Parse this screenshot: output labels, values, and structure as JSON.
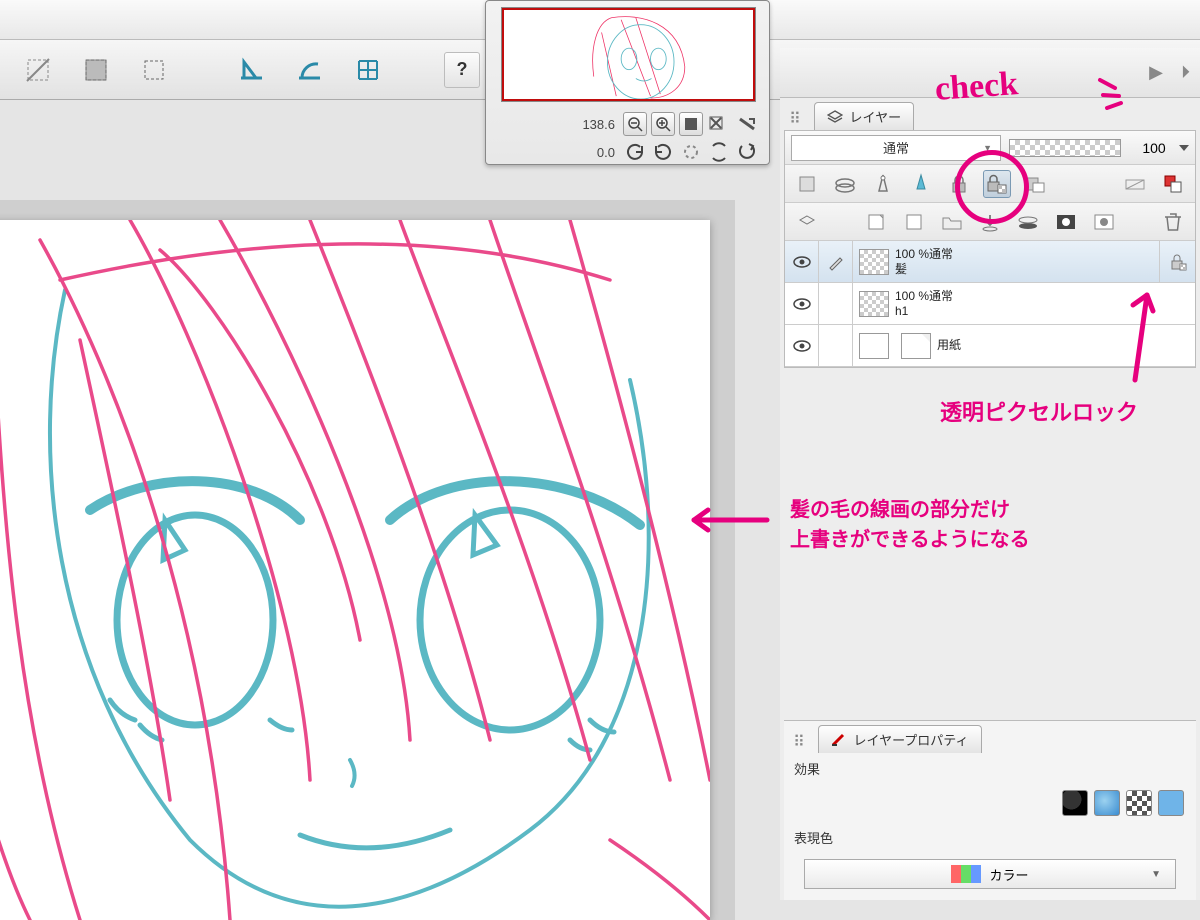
{
  "navigator": {
    "zoom": "138.6",
    "rotation": "0.0"
  },
  "layer_panel": {
    "tab_label": "レイヤー",
    "blend_mode": "通常",
    "opacity": "100",
    "layers": [
      {
        "opacity_label": "100 %通常",
        "name": "髪",
        "locked": true
      },
      {
        "opacity_label": "100 %通常",
        "name": "h1",
        "locked": false
      },
      {
        "opacity_label": "",
        "name": "用紙",
        "locked": false
      }
    ]
  },
  "property_panel": {
    "tab_label": "レイヤープロパティ",
    "effect_label": "効果",
    "express_label": "表現色",
    "color_mode": "カラー"
  },
  "annotations": {
    "check": "check",
    "lock_label": "透明ピクセルロック",
    "canvas_note_l1": "髪の毛の線画の部分だけ",
    "canvas_note_l2": "上書きができるようになる"
  }
}
